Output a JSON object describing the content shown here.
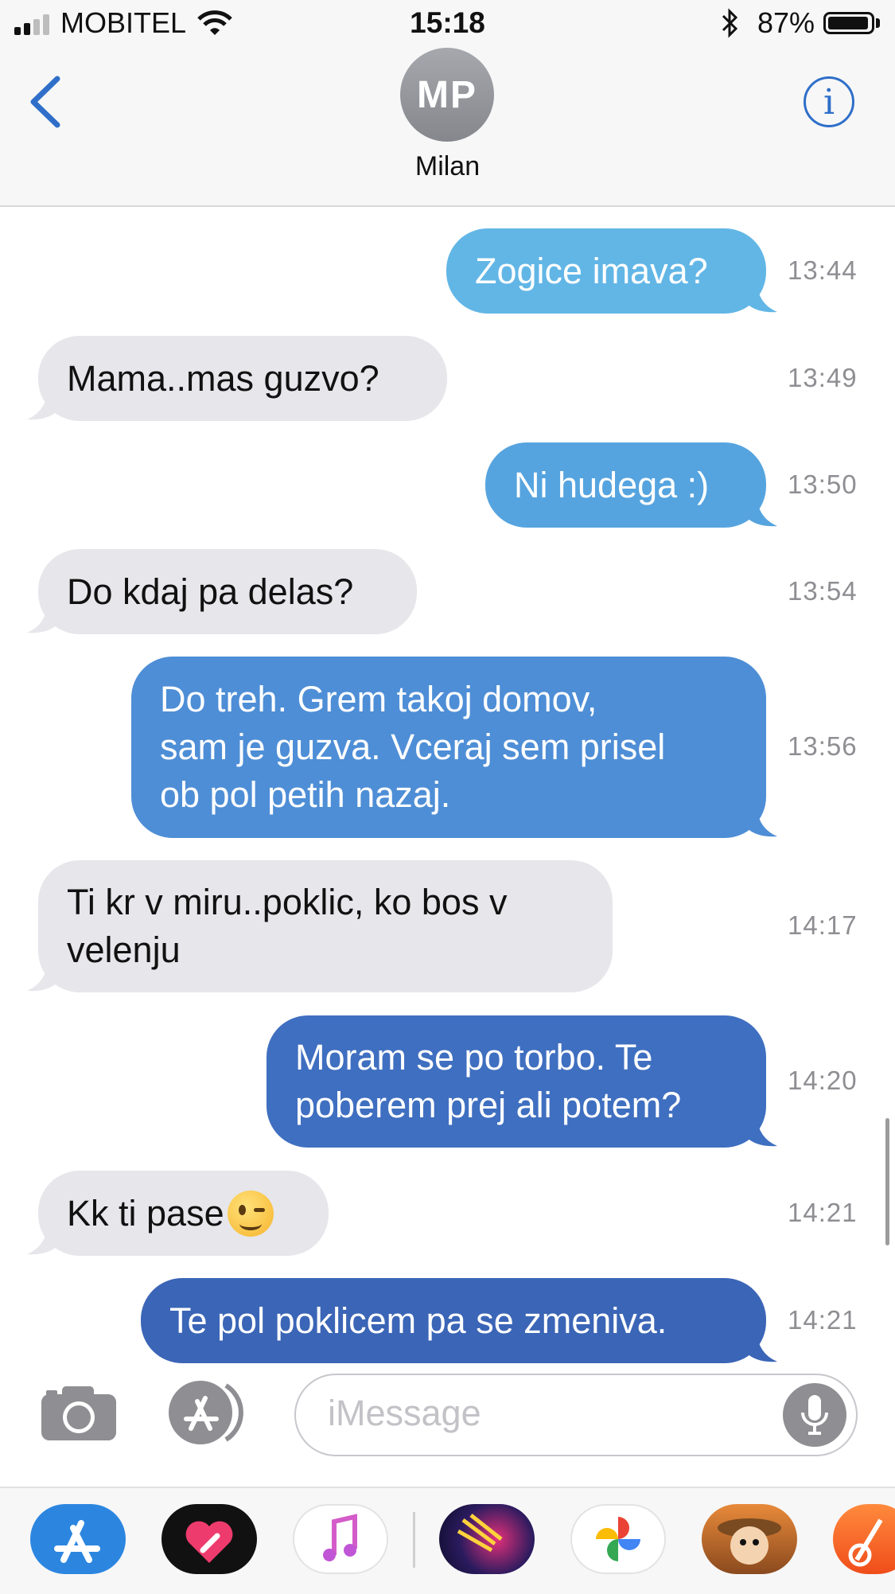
{
  "status_bar": {
    "carrier": "MOBITEL",
    "time": "15:18",
    "battery": "87%",
    "battery_level": 0.87
  },
  "header": {
    "avatar_initials": "MP",
    "contact_name": "Milan"
  },
  "messages": [
    {
      "direction": "out",
      "text": "Zogice imava?",
      "time": "13:44"
    },
    {
      "direction": "in",
      "text": "Mama..mas guzvo?",
      "time": "13:49"
    },
    {
      "direction": "out",
      "text": "Ni hudega :)",
      "time": "13:50"
    },
    {
      "direction": "in",
      "text": "Do kdaj pa delas?",
      "time": "13:54"
    },
    {
      "direction": "out",
      "text": "Do treh. Grem takoj domov,\nsam je guzva. Vceraj sem prisel\nob pol petih nazaj.",
      "time": "13:56"
    },
    {
      "direction": "in",
      "text": "Ti kr v miru..poklic, ko bos v\nvelenju",
      "time": "14:17"
    },
    {
      "direction": "out",
      "text": "Moram se po torbo. Te\npoberem prej ali potem?",
      "time": "14:20"
    },
    {
      "direction": "in",
      "text": "Kk ti pase",
      "time": "14:21",
      "emoji": "winking-face"
    },
    {
      "direction": "out",
      "text": "Te pol poklicem pa se zmeniva.",
      "time": "14:21"
    }
  ],
  "input": {
    "placeholder": "iMessage"
  },
  "app_drawer": [
    "app-store",
    "digital-touch",
    "music",
    "darts-game",
    "google-photos",
    "south-park-game",
    "garageband"
  ],
  "colors": {
    "incoming_bubble": "#e6e6eb",
    "accent": "#2f6fc9"
  }
}
